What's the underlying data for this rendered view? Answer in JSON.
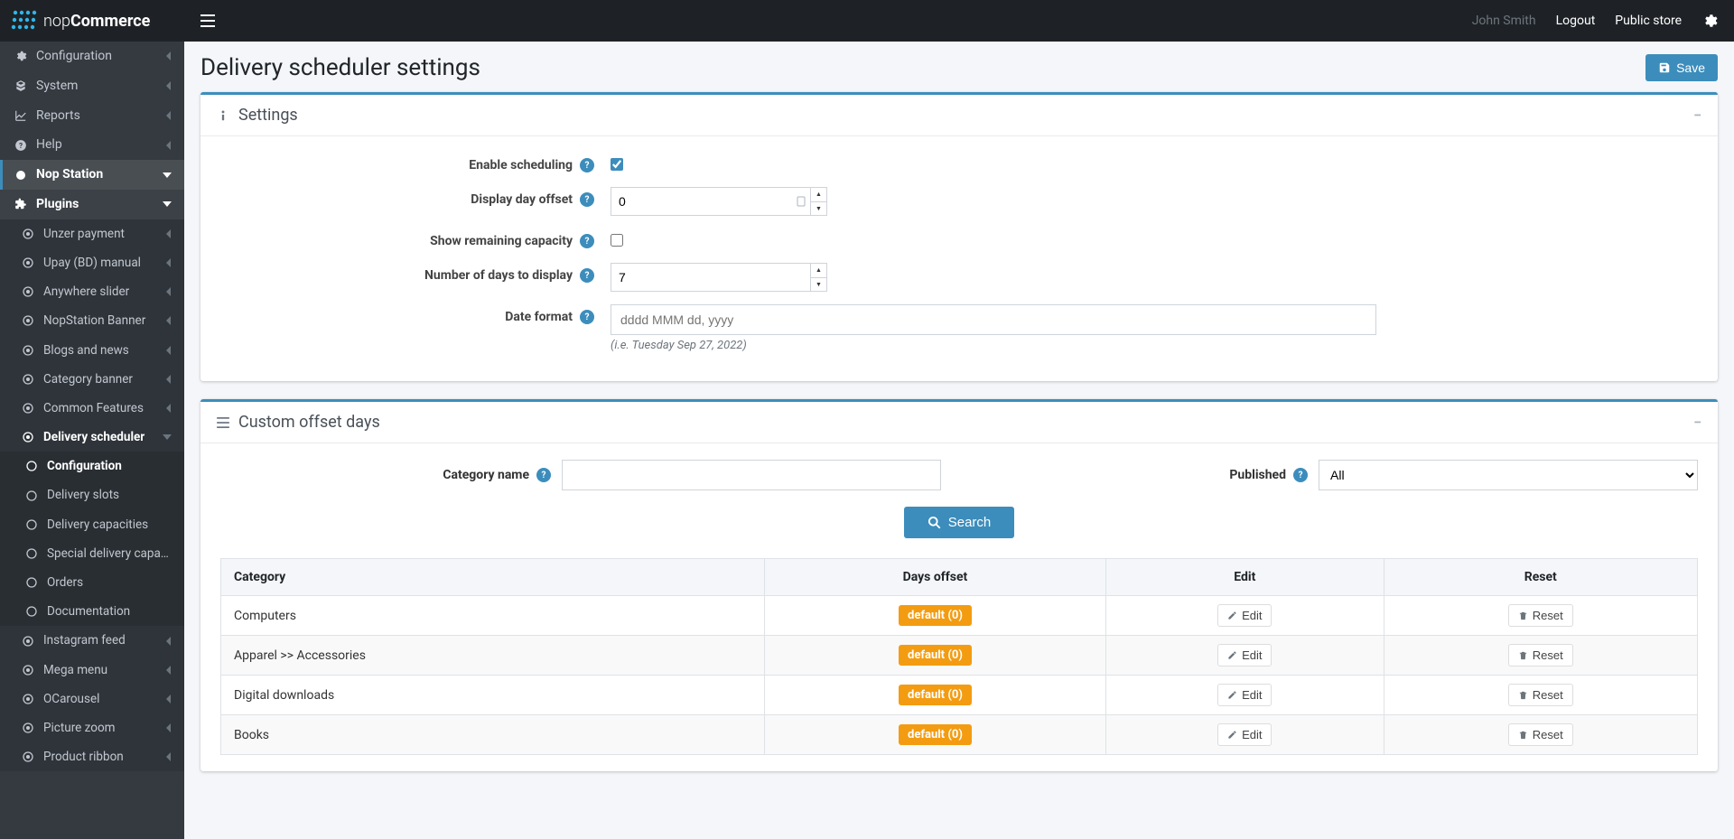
{
  "brand": {
    "text_prefix": "nop",
    "text_bold": "Commerce"
  },
  "topbar": {
    "user": "John Smith",
    "logout": "Logout",
    "public_store": "Public store"
  },
  "sidebar": {
    "top": [
      {
        "icon": "cogs",
        "label": "Configuration",
        "caret": "left"
      },
      {
        "icon": "cubes",
        "label": "System",
        "caret": "left"
      },
      {
        "icon": "chart-line",
        "label": "Reports",
        "caret": "left"
      },
      {
        "icon": "question-circle",
        "label": "Help",
        "caret": "left"
      }
    ],
    "nop_station": {
      "icon": "circle-fill",
      "label": "Nop Station",
      "caret": "down"
    },
    "plugins": {
      "icon": "puzzle",
      "label": "Plugins",
      "caret": "down"
    },
    "plugin_items_before": [
      {
        "label": "Unzer payment",
        "caret": "left"
      },
      {
        "label": "Upay (BD) manual",
        "caret": "left"
      },
      {
        "label": "Anywhere slider",
        "caret": "left"
      },
      {
        "label": "NopStation Banner",
        "caret": "left"
      },
      {
        "label": "Blogs and news",
        "caret": "left"
      },
      {
        "label": "Category banner",
        "caret": "left"
      },
      {
        "label": "Common Features",
        "caret": "left"
      }
    ],
    "delivery_scheduler": {
      "label": "Delivery scheduler",
      "caret": "down"
    },
    "delivery_children": [
      {
        "label": "Configuration",
        "active": true
      },
      {
        "label": "Delivery slots"
      },
      {
        "label": "Delivery capacities"
      },
      {
        "label": "Special delivery capacities"
      },
      {
        "label": "Orders"
      },
      {
        "label": "Documentation"
      }
    ],
    "plugin_items_after": [
      {
        "label": "Instagram feed",
        "caret": "left"
      },
      {
        "label": "Mega menu",
        "caret": "left"
      },
      {
        "label": "OCarousel",
        "caret": "left"
      },
      {
        "label": "Picture zoom",
        "caret": "left"
      },
      {
        "label": "Product ribbon",
        "caret": "left"
      }
    ]
  },
  "page": {
    "title": "Delivery scheduler settings",
    "save_label": "Save"
  },
  "settings_card": {
    "title": "Settings",
    "enable_scheduling": {
      "label": "Enable scheduling",
      "checked": true
    },
    "display_day_offset": {
      "label": "Display day offset",
      "value": "0"
    },
    "show_remaining_capacity": {
      "label": "Show remaining capacity",
      "checked": false
    },
    "number_of_days": {
      "label": "Number of days to display",
      "value": "7"
    },
    "date_format": {
      "label": "Date format",
      "placeholder": "dddd MMM dd, yyyy",
      "hint": "(i.e. Tuesday Sep 27, 2022)"
    }
  },
  "offset_card": {
    "title": "Custom offset days",
    "category_name_label": "Category name",
    "category_name_value": "",
    "published_label": "Published",
    "published_value": "All",
    "published_options": [
      "All"
    ],
    "search_label": "Search",
    "table": {
      "headers": {
        "category": "Category",
        "days_offset": "Days offset",
        "edit": "Edit",
        "reset": "Reset"
      },
      "rows": [
        {
          "category": "Computers",
          "offset": "default (0)",
          "edit": "Edit",
          "reset": "Reset"
        },
        {
          "category": "Apparel >> Accessories",
          "offset": "default (0)",
          "edit": "Edit",
          "reset": "Reset"
        },
        {
          "category": "Digital downloads",
          "offset": "default (0)",
          "edit": "Edit",
          "reset": "Reset"
        },
        {
          "category": "Books",
          "offset": "default (0)",
          "edit": "Edit",
          "reset": "Reset"
        }
      ]
    }
  }
}
